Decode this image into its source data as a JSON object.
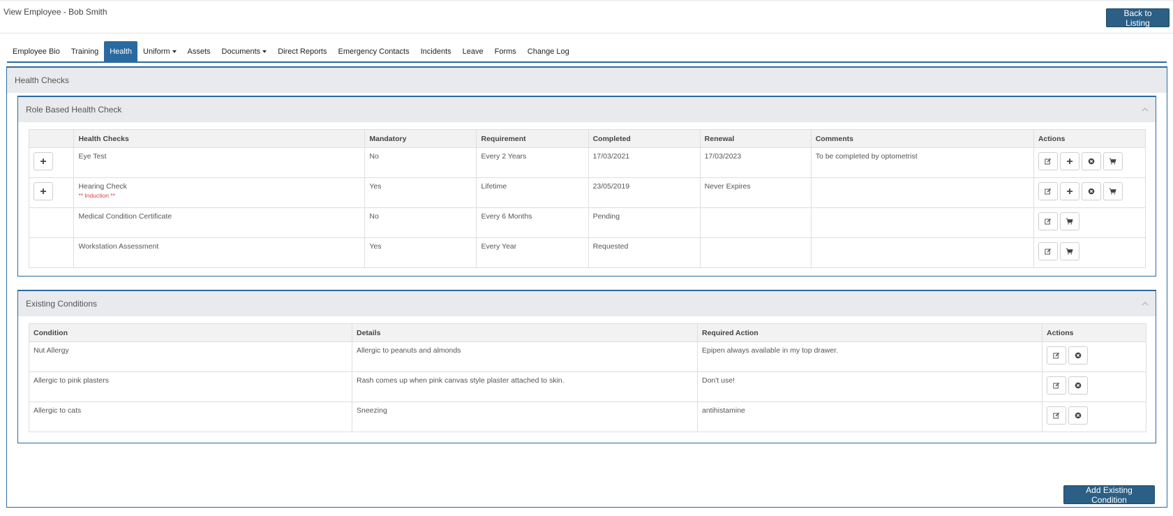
{
  "header": {
    "title": "View Employee - Bob Smith",
    "back_label": "Back to Listing"
  },
  "tabs": [
    {
      "label": "Employee Bio",
      "dropdown": false,
      "active": false
    },
    {
      "label": "Training",
      "dropdown": false,
      "active": false
    },
    {
      "label": "Health",
      "dropdown": false,
      "active": true
    },
    {
      "label": "Uniform",
      "dropdown": true,
      "active": false
    },
    {
      "label": "Assets",
      "dropdown": false,
      "active": false
    },
    {
      "label": "Documents",
      "dropdown": true,
      "active": false
    },
    {
      "label": "Direct Reports",
      "dropdown": false,
      "active": false
    },
    {
      "label": "Emergency Contacts",
      "dropdown": false,
      "active": false
    },
    {
      "label": "Incidents",
      "dropdown": false,
      "active": false
    },
    {
      "label": "Leave",
      "dropdown": false,
      "active": false
    },
    {
      "label": "Forms",
      "dropdown": false,
      "active": false
    },
    {
      "label": "Change Log",
      "dropdown": false,
      "active": false
    }
  ],
  "health_checks_panel": {
    "title": "Health Checks"
  },
  "role_based": {
    "title": "Role Based Health Check",
    "columns": [
      "",
      "Health Checks",
      "Mandatory",
      "Requirement",
      "Completed",
      "Renewal",
      "Comments",
      "Actions"
    ],
    "rows": [
      {
        "expand": true,
        "name": "Eye Test",
        "note": "",
        "mandatory": "No",
        "requirement": "Every 2 Years",
        "completed": "17/03/2021",
        "renewal": "17/03/2023",
        "comments": "To be completed by optometrist",
        "actions": [
          "edit-icon",
          "plus-icon",
          "remove-icon",
          "cart-icon"
        ]
      },
      {
        "expand": true,
        "name": "Hearing Check",
        "note": "** Induction **",
        "mandatory": "Yes",
        "requirement": "Lifetime",
        "completed": "23/05/2019",
        "renewal": "Never Expires",
        "comments": "",
        "actions": [
          "edit-icon",
          "plus-icon",
          "remove-icon",
          "cart-icon"
        ]
      },
      {
        "expand": false,
        "name": "Medical Condition Certificate",
        "note": "",
        "mandatory": "No",
        "requirement": "Every 6 Months",
        "completed": "Pending",
        "renewal": "",
        "comments": "",
        "actions": [
          "edit-icon",
          "cart-icon"
        ]
      },
      {
        "expand": false,
        "name": "Workstation Assessment",
        "note": "",
        "mandatory": "Yes",
        "requirement": "Every Year",
        "completed": "Requested",
        "renewal": "",
        "comments": "",
        "actions": [
          "edit-icon",
          "cart-icon"
        ]
      }
    ]
  },
  "existing_conditions": {
    "title": "Existing Conditions",
    "columns": [
      "Condition",
      "Details",
      "Required Action",
      "Actions"
    ],
    "rows": [
      {
        "condition": "Nut Allergy",
        "details": "Allergic to peanuts and almonds",
        "required_action": "Epipen always available in my top drawer."
      },
      {
        "condition": "Allergic to pink plasters",
        "details": "Rash comes up when pink canvas style plaster attached to skin.",
        "required_action": "Don't use!"
      },
      {
        "condition": "Allergic to cats",
        "details": "Sneezing",
        "required_action": "antihistamine"
      }
    ],
    "add_label": "Add Existing Condition"
  },
  "colors": {
    "primary": "#2b6aa0",
    "button": "#2b5f85",
    "induction": "#e03a3a",
    "panel_head": "#e8eaed"
  }
}
